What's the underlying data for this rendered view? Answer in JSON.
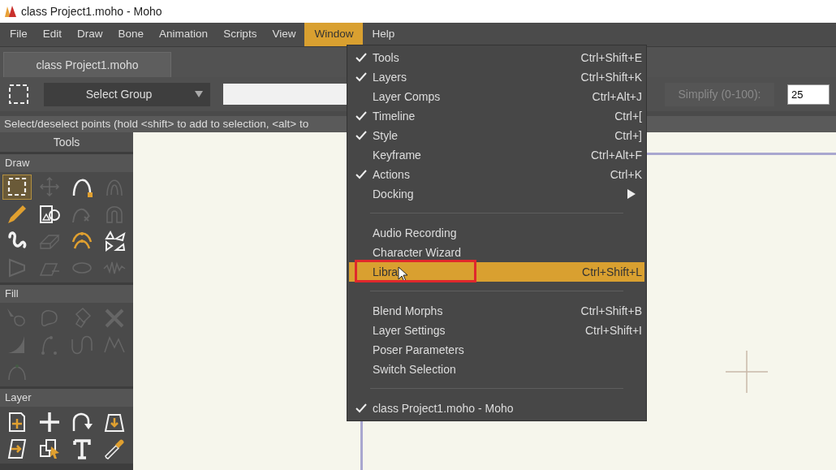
{
  "window": {
    "title": "class Project1.moho - Moho"
  },
  "menu_bar": [
    {
      "label": "File",
      "selected": false
    },
    {
      "label": "Edit",
      "selected": false
    },
    {
      "label": "Draw",
      "selected": false
    },
    {
      "label": "Bone",
      "selected": false
    },
    {
      "label": "Animation",
      "selected": false
    },
    {
      "label": "Scripts",
      "selected": false
    },
    {
      "label": "View",
      "selected": false
    },
    {
      "label": "Window",
      "selected": true
    },
    {
      "label": "Help",
      "selected": false
    }
  ],
  "document_tabs": [
    {
      "label": "class Project1.moho",
      "selected": true
    }
  ],
  "toolbar": {
    "group_select": "Select Group",
    "simplify_label": "Simplify (0-100):",
    "simplify_value": "25"
  },
  "status_text": "Select/deselect points (hold <shift> to add to selection, <alt> to",
  "tools_panel": {
    "title": "Tools",
    "sections": [
      {
        "label": "Draw",
        "tools": [
          {
            "enabled": true,
            "selected": true
          },
          {
            "enabled": false,
            "selected": false
          },
          {
            "enabled": true,
            "selected": false
          },
          {
            "enabled": false,
            "selected": false
          },
          {
            "enabled": true,
            "selected": false
          },
          {
            "enabled": true,
            "selected": false
          },
          {
            "enabled": false,
            "selected": false
          },
          {
            "enabled": false,
            "selected": false
          },
          {
            "enabled": true,
            "selected": false
          },
          {
            "enabled": false,
            "selected": false
          },
          {
            "enabled": true,
            "selected": false
          },
          {
            "enabled": true,
            "selected": false
          },
          {
            "enabled": false,
            "selected": false
          },
          {
            "enabled": false,
            "selected": false
          },
          {
            "enabled": false,
            "selected": false
          },
          {
            "enabled": false,
            "selected": false
          }
        ]
      },
      {
        "label": "Fill",
        "tools": [
          {
            "enabled": false,
            "selected": false
          },
          {
            "enabled": false,
            "selected": false
          },
          {
            "enabled": false,
            "selected": false
          },
          {
            "enabled": false,
            "selected": false
          },
          {
            "enabled": false,
            "selected": false
          },
          {
            "enabled": false,
            "selected": false
          },
          {
            "enabled": false,
            "selected": false
          },
          {
            "enabled": false,
            "selected": false
          },
          {
            "enabled": false,
            "selected": false
          }
        ]
      },
      {
        "label": "Layer",
        "tools": [
          {
            "enabled": true,
            "selected": false
          },
          {
            "enabled": true,
            "selected": false
          },
          {
            "enabled": true,
            "selected": false
          },
          {
            "enabled": true,
            "selected": false
          },
          {
            "enabled": true,
            "selected": false
          },
          {
            "enabled": true,
            "selected": false
          },
          {
            "enabled": true,
            "selected": false
          },
          {
            "enabled": true,
            "selected": false
          }
        ]
      }
    ]
  },
  "window_menu": {
    "items": [
      {
        "kind": "item",
        "label": "Tools",
        "shortcut": "Ctrl+Shift+E",
        "checked": true,
        "selected": false
      },
      {
        "kind": "item",
        "label": "Layers",
        "shortcut": "Ctrl+Shift+K",
        "checked": true,
        "selected": false
      },
      {
        "kind": "item",
        "label": "Layer Comps",
        "shortcut": "Ctrl+Alt+J",
        "checked": false,
        "selected": false
      },
      {
        "kind": "item",
        "label": "Timeline",
        "shortcut": "Ctrl+[",
        "checked": true,
        "selected": false
      },
      {
        "kind": "item",
        "label": "Style",
        "shortcut": "Ctrl+]",
        "checked": true,
        "selected": false
      },
      {
        "kind": "item",
        "label": "Keyframe",
        "shortcut": "Ctrl+Alt+F",
        "checked": false,
        "selected": false
      },
      {
        "kind": "item",
        "label": "Actions",
        "shortcut": "Ctrl+K",
        "checked": true,
        "selected": false
      },
      {
        "kind": "submenu",
        "label": "Docking",
        "checked": false,
        "selected": false
      },
      {
        "kind": "separator"
      },
      {
        "kind": "item",
        "label": "Audio Recording",
        "checked": false,
        "selected": false
      },
      {
        "kind": "item",
        "label": "Character Wizard",
        "checked": false,
        "selected": false
      },
      {
        "kind": "item",
        "label": "Libra",
        "shortcut": "Ctrl+Shift+L",
        "checked": false,
        "selected": true
      },
      {
        "kind": "separator"
      },
      {
        "kind": "item",
        "label": "Blend Morphs",
        "shortcut": "Ctrl+Shift+B",
        "checked": false,
        "selected": false
      },
      {
        "kind": "item",
        "label": "Layer Settings",
        "shortcut": "Ctrl+Shift+I",
        "checked": false,
        "selected": false
      },
      {
        "kind": "item",
        "label": "Poser Parameters",
        "checked": false,
        "selected": false
      },
      {
        "kind": "item",
        "label": "Switch Selection",
        "checked": false,
        "selected": false
      },
      {
        "kind": "separator"
      },
      {
        "kind": "item",
        "label": "class Project1.moho - Moho",
        "checked": true,
        "selected": false
      }
    ]
  }
}
